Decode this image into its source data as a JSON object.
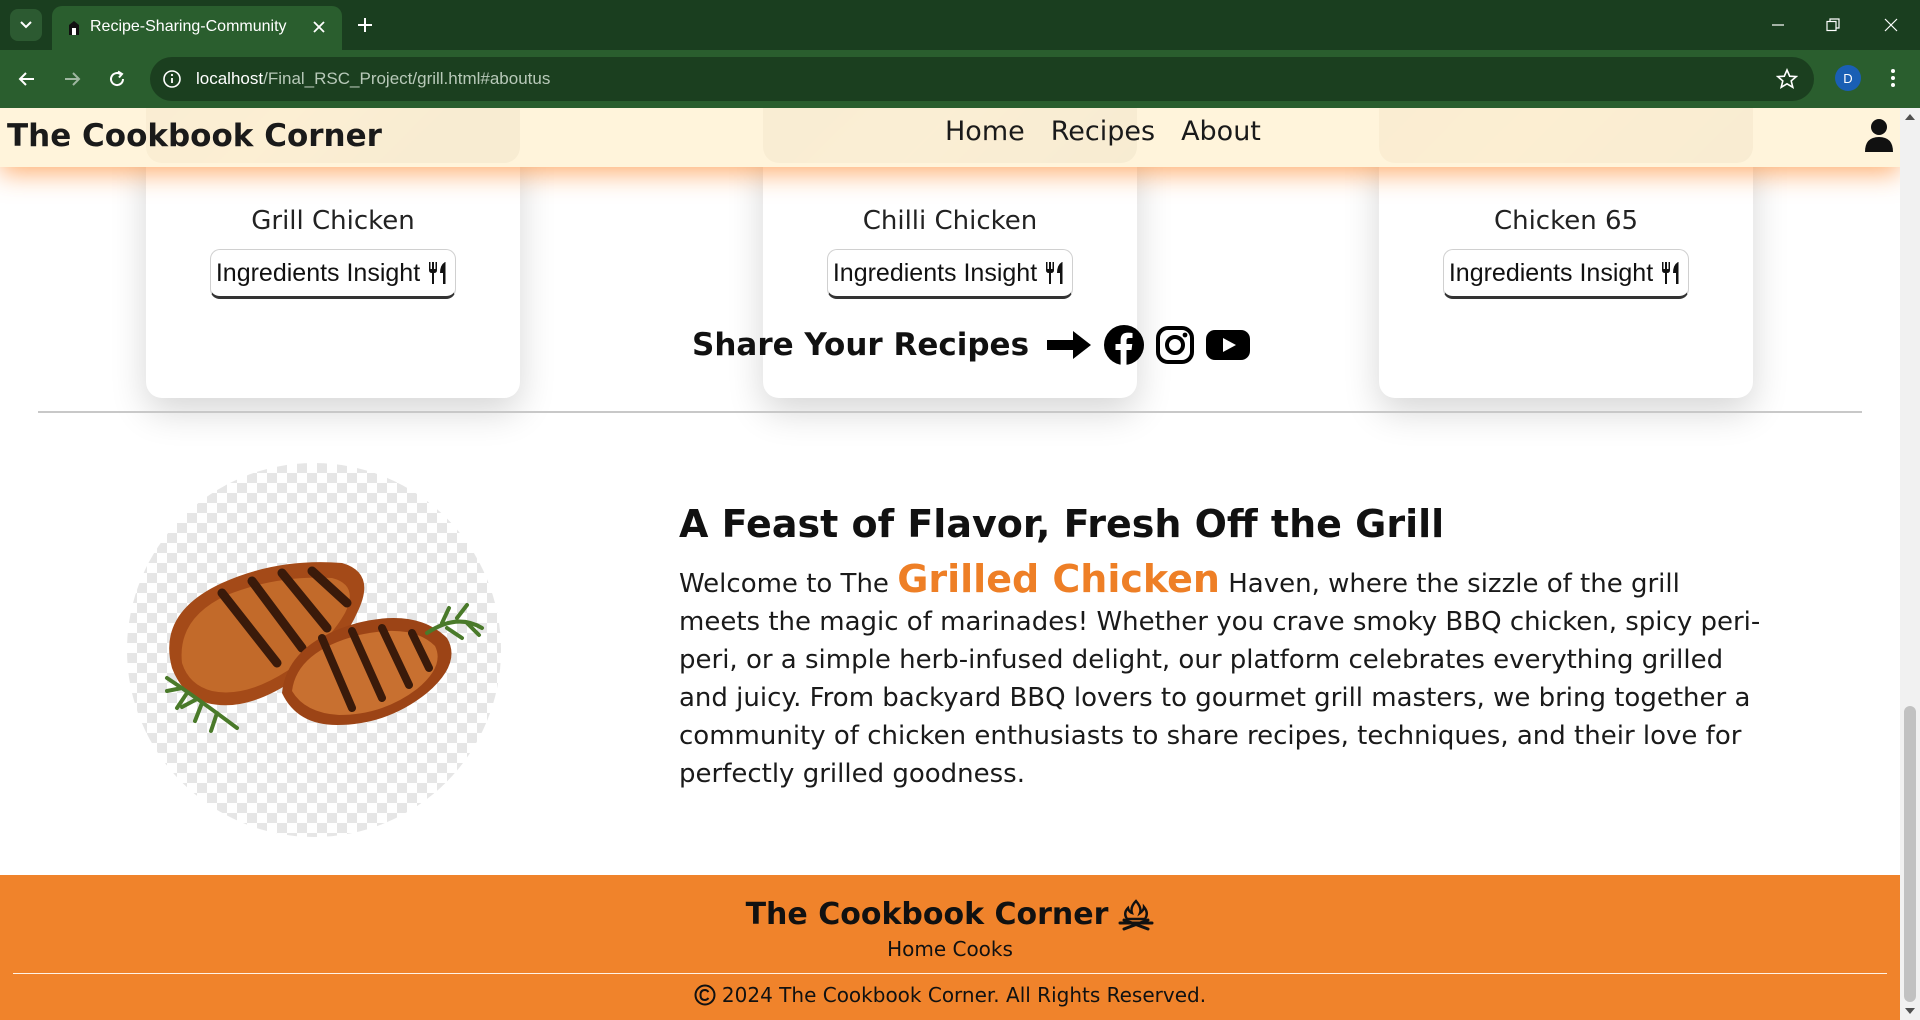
{
  "browser": {
    "tab_title": "Recipe-Sharing-Community",
    "url_host": "localhost",
    "url_path": "/Final_RSC_Project/grill.html#aboutus",
    "profile_initial": "D"
  },
  "navbar": {
    "brand": "The Cookbook Corner",
    "links": [
      "Home",
      "Recipes",
      "About"
    ]
  },
  "recipes": [
    {
      "name": "Grill Chicken",
      "button": "Ingredients Insight"
    },
    {
      "name": "Chilli Chicken",
      "button": "Ingredients Insight"
    },
    {
      "name": "Chicken 65",
      "button": "Ingredients Insight"
    }
  ],
  "share": {
    "label": "Share Your Recipes",
    "icons": [
      "arrow-right-icon",
      "facebook-icon",
      "instagram-icon",
      "youtube-icon"
    ]
  },
  "about": {
    "heading": "A Feast of Flavor, Fresh Off the Grill",
    "intro": "Welcome to The ",
    "highlight": "Grilled Chicken",
    "body": " Haven, where the sizzle of the grill meets the magic of marinades! Whether you crave smoky BBQ chicken, spicy peri-peri, or a simple herb-infused delight, our platform celebrates everything grilled and juicy. From backyard BBQ lovers to gourmet grill masters, we bring together a community of chicken enthusiasts to share recipes, techniques, and their love for perfectly grilled goodness."
  },
  "footer": {
    "brand": "The Cookbook Corner",
    "tagline": "Home Cooks",
    "copyright": "2024 The Cookbook Corner. All Rights Reserved."
  },
  "colors": {
    "browser_frame": "#1a3e1f",
    "accent": "#ee7f26",
    "footer_bg": "#f0832b",
    "navbar_bg": "#fff4da"
  }
}
